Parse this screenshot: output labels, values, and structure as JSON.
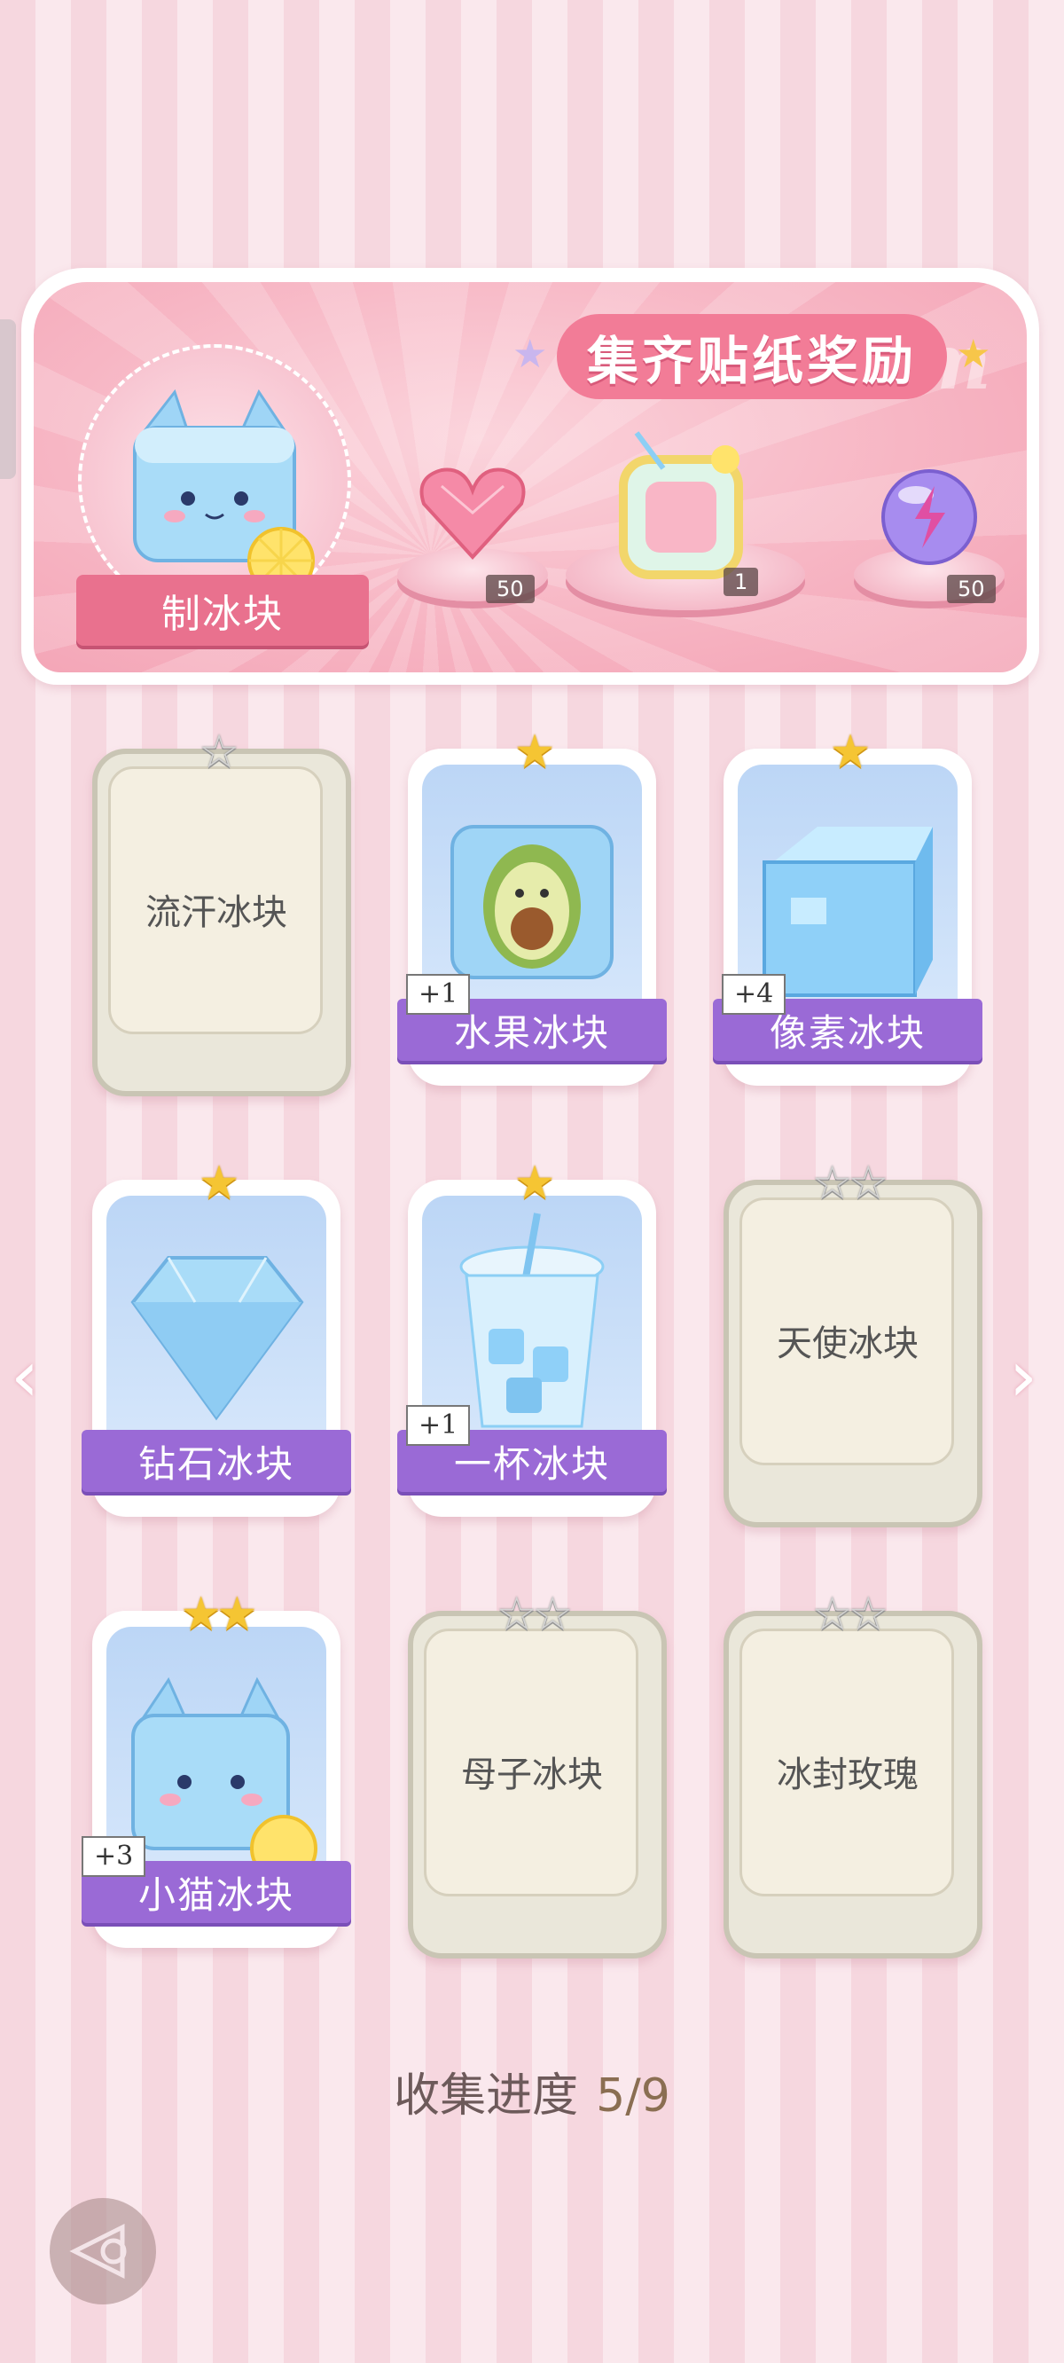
{
  "banner": {
    "title": "集齐贴纸奖励",
    "watermark": "Redeem",
    "make_button": "制冰块",
    "rewards": [
      {
        "icon": "heart-gem-icon",
        "qty": "50"
      },
      {
        "icon": "drink-frame-icon",
        "qty": "1"
      },
      {
        "icon": "energy-orb-icon",
        "qty": "50"
      }
    ]
  },
  "cards": [
    {
      "name": "流汗冰块",
      "locked": true,
      "stars": "☆",
      "plus": ""
    },
    {
      "name": "水果冰块",
      "locked": false,
      "stars": "★",
      "plus": "+1"
    },
    {
      "name": "像素冰块",
      "locked": false,
      "stars": "★",
      "plus": "+4"
    },
    {
      "name": "钻石冰块",
      "locked": false,
      "stars": "★",
      "plus": ""
    },
    {
      "name": "一杯冰块",
      "locked": false,
      "stars": "★",
      "plus": "+1"
    },
    {
      "name": "天使冰块",
      "locked": true,
      "stars": "☆☆",
      "plus": ""
    },
    {
      "name": "小猫冰块",
      "locked": false,
      "stars": "★★",
      "plus": "+3"
    },
    {
      "name": "母子冰块",
      "locked": true,
      "stars": "☆☆",
      "plus": ""
    },
    {
      "name": "冰封玫瑰",
      "locked": true,
      "stars": "☆☆",
      "plus": ""
    }
  ],
  "progress": {
    "label": "收集进度",
    "value": "5/9"
  },
  "colors": {
    "accent": "#9a6ad6",
    "pink": "#f27c97",
    "gold_star": "#f5c533"
  }
}
